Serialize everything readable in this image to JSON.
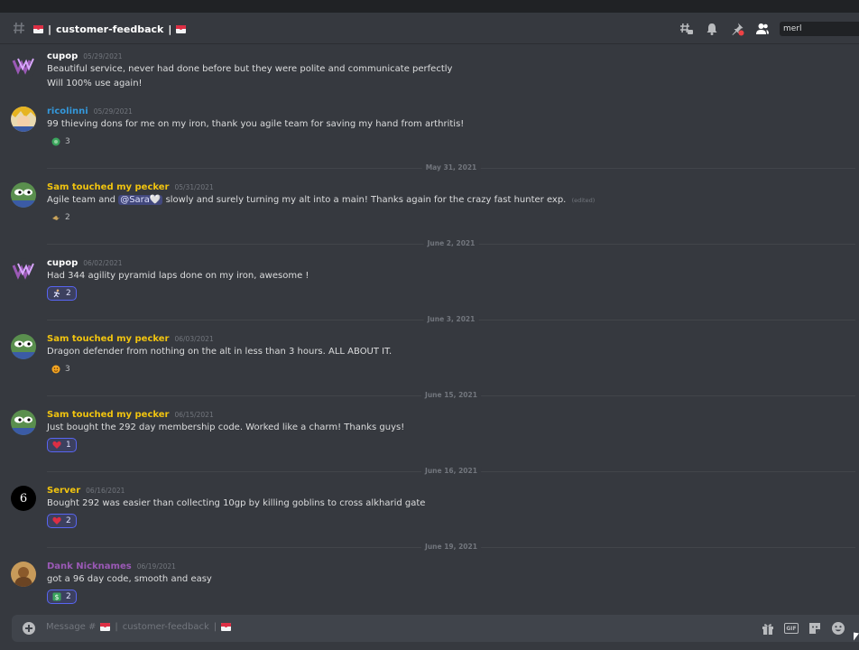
{
  "header": {
    "channel_name": "customer-feedback",
    "search_value": "merl"
  },
  "colors": {
    "background": "#36393f",
    "yellow_author": "#f1c40f",
    "white_author": "#ffffff",
    "blue_author": "#3498db",
    "purple_author": "#9b59b6",
    "reaction_border": "#5865f2"
  },
  "messages": [
    {
      "author": "cupop",
      "timestamp": "05/29/2021",
      "lines": [
        "Beautiful service, never had done before but they were polite and communicate perfectly",
        "Will 100% use again!"
      ]
    },
    {
      "author": "ricolinni",
      "timestamp": "05/29/2021",
      "lines": [
        "99 thieving dons for me on my iron, thank you agile team for saving my hand from arthritis!"
      ],
      "reaction": {
        "emoji": "green-circle-emoji",
        "count": "3"
      }
    },
    {
      "author": "Sam touched my pecker",
      "timestamp": "05/31/2021",
      "text_before": "Agile team and",
      "mention": "@Sara🤍",
      "text_after": "slowly and surely turning my alt into a main! Thanks again for the crazy fast hunter exp.",
      "edited": "(edited)",
      "reaction": {
        "emoji": "bird-emoji",
        "count": "2"
      }
    },
    {
      "author": "cupop",
      "timestamp": "06/02/2021",
      "lines": [
        "Had 344 agility pyramid laps done on my iron, awesome !"
      ],
      "reaction": {
        "emoji": "runner-emoji",
        "count": "2"
      }
    },
    {
      "author": "Sam touched my pecker",
      "timestamp": "06/03/2021",
      "lines": [
        "Dragon defender from nothing on the alt in less than 3 hours. ALL ABOUT IT."
      ],
      "reaction": {
        "emoji": "fire-face-emoji",
        "count": "3"
      }
    },
    {
      "author": "Sam touched my pecker",
      "timestamp": "06/15/2021",
      "lines": [
        "Just bought the 292 day membership code. Worked like a charm! Thanks guys!"
      ],
      "reaction": {
        "emoji": "heart-emoji",
        "count": "1"
      }
    },
    {
      "author": "Server",
      "timestamp": "06/16/2021",
      "lines": [
        "Bought 292 was easier than collecting 10gp by killing goblins to cross alkharid gate"
      ],
      "reaction": {
        "emoji": "heart-emoji",
        "count": "2"
      }
    },
    {
      "author": "Dank Nicknames",
      "timestamp": "06/19/2021",
      "lines": [
        "got a 96 day code, smooth and easy"
      ],
      "reaction": {
        "emoji": "dollar-emoji",
        "count": "2"
      }
    }
  ],
  "dividers": [
    "May 31, 2021",
    "June 2, 2021",
    "June 3, 2021",
    "June 15, 2021",
    "June 16, 2021",
    "June 19, 2021"
  ],
  "avatars": {
    "server_avatar_text": "6"
  },
  "composer": {
    "placeholder_prefix": "Message #",
    "placeholder_channel": "customer-feedback"
  }
}
